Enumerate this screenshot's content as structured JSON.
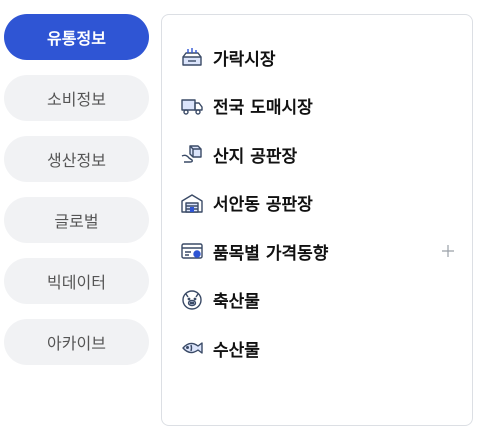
{
  "tabs": [
    {
      "label": "유통정보",
      "active": true
    },
    {
      "label": "소비정보",
      "active": false
    },
    {
      "label": "생산정보",
      "active": false
    },
    {
      "label": "글로벌",
      "active": false
    },
    {
      "label": "빅데이터",
      "active": false
    },
    {
      "label": "아카이브",
      "active": false
    }
  ],
  "menu": {
    "items": [
      {
        "label": "가락시장",
        "icon": "market-icon"
      },
      {
        "label": "전국 도매시장",
        "icon": "truck-icon"
      },
      {
        "label": "산지 공판장",
        "icon": "box-hand-icon"
      },
      {
        "label": "서안동 공판장",
        "icon": "warehouse-icon"
      },
      {
        "label": "품목별 가격동향",
        "icon": "price-card-icon",
        "expandable": true
      },
      {
        "label": "축산물",
        "icon": "pig-icon"
      },
      {
        "label": "수산물",
        "icon": "fish-icon"
      }
    ]
  },
  "colors": {
    "accent": "#2f55d4",
    "icon_stroke": "#3a4a66",
    "tab_bg": "#f1f2f4"
  }
}
